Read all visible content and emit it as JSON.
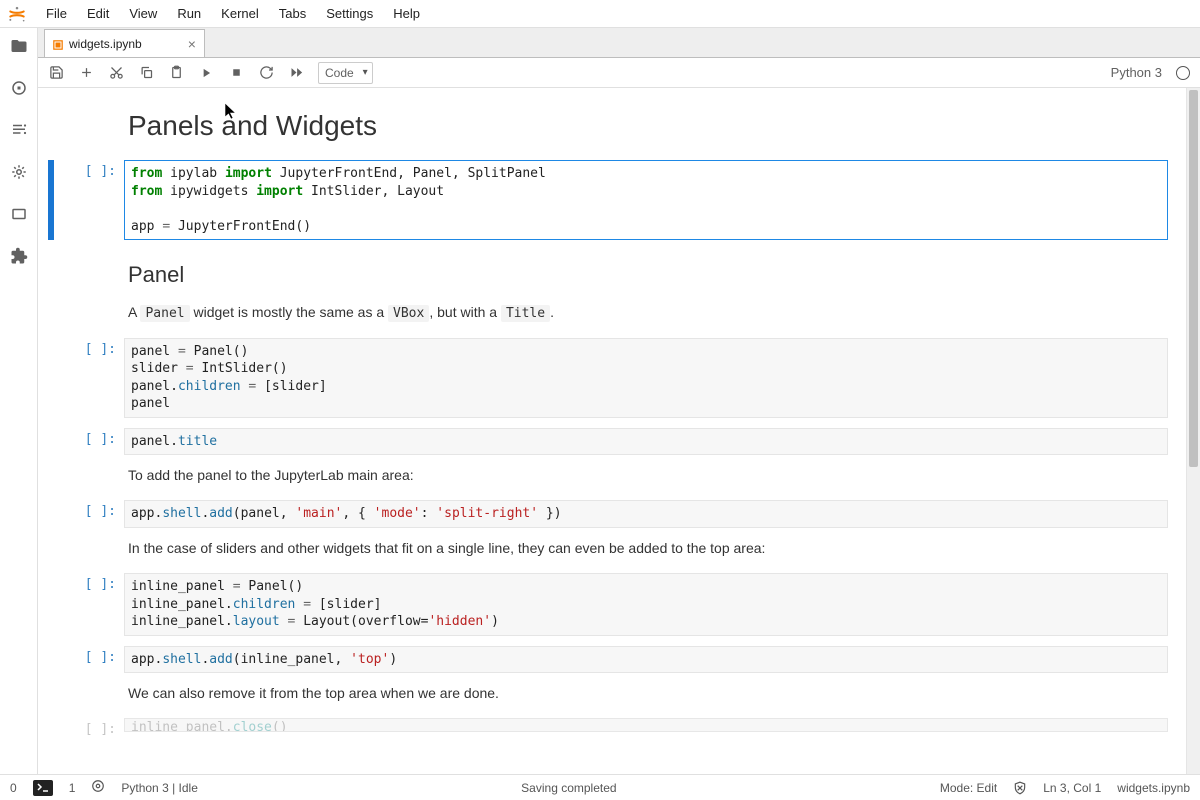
{
  "menus": [
    "File",
    "Edit",
    "View",
    "Run",
    "Kernel",
    "Tabs",
    "Settings",
    "Help"
  ],
  "tab": {
    "label": "widgets.ipynb"
  },
  "toolbar": {
    "celltype": "Code",
    "kernel_name": "Python 3"
  },
  "prompts": {
    "empty": "[ ]:"
  },
  "doc": {
    "h1": "Panels and Widgets",
    "h2": "Panel",
    "p1_a": "A ",
    "p1_code1": "Panel",
    "p1_b": " widget is mostly the same as a ",
    "p1_code2": "VBox",
    "p1_c": ", but with a ",
    "p1_code3": "Title",
    "p1_d": ".",
    "p2": "To add the panel to the JupyterLab main area:",
    "p3": "In the case of sliders and other widgets that fit on a single line, they can even be added to the top area:",
    "p4": "We can also remove it from the top area when we are done."
  },
  "code": {
    "c1_l1a": "from",
    "c1_l1b": " ipylab ",
    "c1_l1c": "import",
    "c1_l1d": " JupyterFrontEnd, Panel, SplitPanel",
    "c1_l2a": "from",
    "c1_l2b": " ipywidgets ",
    "c1_l2c": "import",
    "c1_l2d": " IntSlider, Layout",
    "c1_l3": "",
    "c1_l4a": "app ",
    "c1_l4b": "=",
    "c1_l4c": " JupyterFrontEnd()",
    "c2_l1a": "panel ",
    "c2_l1b": "=",
    "c2_l1c": " Panel()",
    "c2_l2a": "slider ",
    "c2_l2b": "=",
    "c2_l2c": " IntSlider()",
    "c2_l3a": "panel.",
    "c2_l3b": "children",
    "c2_l3c": " ",
    "c2_l3d": "=",
    "c2_l3e": " [slider]",
    "c2_l4": "panel",
    "c3_a": "panel.",
    "c3_b": "title",
    "c4_a": "app.",
    "c4_b": "shell",
    "c4_c": ".",
    "c4_d": "add",
    "c4_e": "(panel, ",
    "c4_f": "'main'",
    "c4_g": ", { ",
    "c4_h": "'mode'",
    "c4_i": ": ",
    "c4_j": "'split-right'",
    "c4_k": " })",
    "c5_l1a": "inline_panel ",
    "c5_l1b": "=",
    "c5_l1c": " Panel()",
    "c5_l2a": "inline_panel.",
    "c5_l2b": "children",
    "c5_l2c": " ",
    "c5_l2d": "=",
    "c5_l2e": " [slider]",
    "c5_l3a": "inline_panel.",
    "c5_l3b": "layout",
    "c5_l3c": " ",
    "c5_l3d": "=",
    "c5_l3e": " Layout(overflow=",
    "c5_l3f": "'hidden'",
    "c5_l3g": ")",
    "c6_a": "app.",
    "c6_b": "shell",
    "c6_c": ".",
    "c6_d": "add",
    "c6_e": "(inline_panel, ",
    "c6_f": "'top'",
    "c6_g": ")",
    "c7_a": "inline_panel.",
    "c7_b": "close",
    "c7_c": "()"
  },
  "status": {
    "terms": "0",
    "kernels": "1",
    "kernel": "Python 3 | Idle",
    "saving": "Saving completed",
    "mode": "Mode: Edit",
    "cursor": "Ln 3, Col 1",
    "file": "widgets.ipynb"
  }
}
